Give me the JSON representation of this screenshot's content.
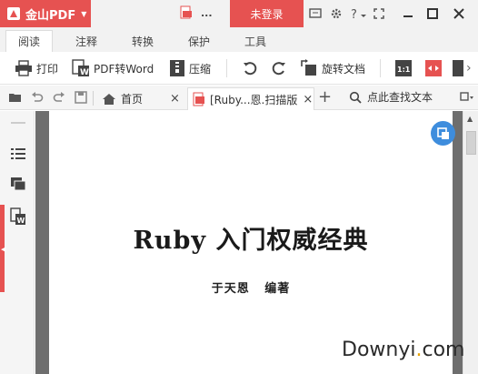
{
  "titlebar": {
    "app_name": "金山PDF",
    "doc_title": "...",
    "login_label": "未登录"
  },
  "menu": {
    "tabs": [
      {
        "label": "阅读",
        "active": true
      },
      {
        "label": "注释",
        "active": false
      },
      {
        "label": "转换",
        "active": false
      },
      {
        "label": "保护",
        "active": false
      },
      {
        "label": "工具",
        "active": false
      }
    ]
  },
  "ribbon": {
    "print": "打印",
    "pdf_to_word": "PDF转Word",
    "compress": "压缩",
    "rotate_doc": "旋转文档"
  },
  "docstrip": {
    "home_tab": "首页",
    "file_tab": "[Ruby...恩.扫描版",
    "close_glyph": "×",
    "new_tab_glyph": "+",
    "search_label": "点此查找文本"
  },
  "page": {
    "title": "Ruby 入门权威经典",
    "author": "于天恩   编著"
  },
  "watermark": {
    "before_dot": "Downyi",
    "dot": ".",
    "after_dot": "com"
  },
  "colors": {
    "accent": "#e65251",
    "float_button": "#3e8ddd",
    "doc_background": "#6e6e6e"
  }
}
